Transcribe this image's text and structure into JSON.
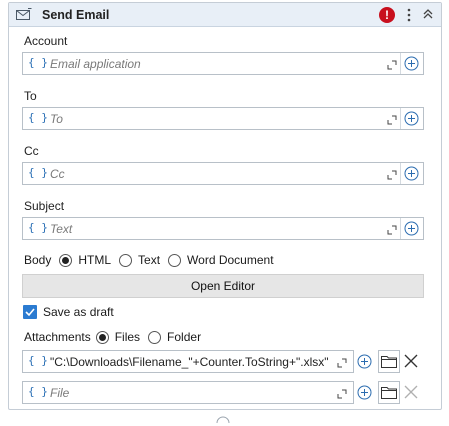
{
  "header": {
    "title": "Send Email",
    "error_icon_text": "!"
  },
  "account": {
    "label": "Account",
    "placeholder": "Email application"
  },
  "to": {
    "label": "To",
    "placeholder": "To"
  },
  "cc": {
    "label": "Cc",
    "placeholder": "Cc"
  },
  "subject": {
    "label": "Subject",
    "placeholder": "Text"
  },
  "braces": "{ }",
  "body": {
    "label": "Body",
    "options": [
      "HTML",
      "Text",
      "Word Document"
    ],
    "selected": "HTML",
    "open_editor_label": "Open Editor"
  },
  "save_as_draft": {
    "label": "Save as draft",
    "checked": true
  },
  "attachments": {
    "label": "Attachments",
    "options": [
      "Files",
      "Folder"
    ],
    "selected": "Files",
    "rows": [
      {
        "value": "\"C:\\Downloads\\Filename_\"+Counter.ToString+\".xlsx\"",
        "placeholder": ""
      },
      {
        "value": "",
        "placeholder": "File"
      }
    ]
  },
  "icons": {
    "mail": "mail-icon",
    "error": "error-icon",
    "more": "kebab-icon",
    "collapse": "double-chevron-up-icon",
    "expand": "expand-arrow-icon",
    "add": "plus-circle-icon",
    "folder": "folder-icon",
    "remove": "x-icon"
  },
  "colors": {
    "header_bg": "#e8eff7",
    "accent": "#2b7bd1",
    "error": "#c8101e"
  }
}
